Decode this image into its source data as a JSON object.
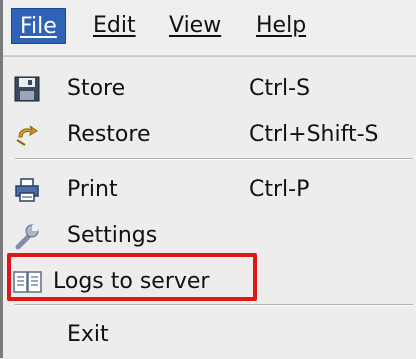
{
  "menubar": {
    "menus": [
      {
        "label": "File",
        "active": true
      },
      {
        "label": "Edit",
        "active": false
      },
      {
        "label": "View",
        "active": false
      },
      {
        "label": "Help",
        "active": false
      }
    ]
  },
  "file_menu": {
    "items": [
      {
        "label": "Store",
        "shortcut": "Ctrl-S",
        "icon": "floppy-disk-icon"
      },
      {
        "label": "Restore",
        "shortcut": "Ctrl+Shift-S",
        "icon": "restore-arrow-icon"
      },
      {
        "label": "Print",
        "shortcut": "Ctrl-P",
        "icon": "printer-icon"
      },
      {
        "label": "Settings",
        "shortcut": "",
        "icon": "wrench-icon"
      },
      {
        "label": "Logs to server",
        "shortcut": "",
        "icon": "document-icon",
        "highlighted": true
      },
      {
        "label": "Exit",
        "shortcut": "",
        "icon": ""
      }
    ]
  },
  "colors": {
    "active_menu_bg": "#2f63b8",
    "highlight_border": "#e11717"
  }
}
